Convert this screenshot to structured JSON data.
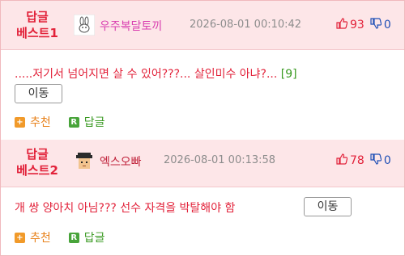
{
  "replies": [
    {
      "best_line1": "답글",
      "best_line2": "베스트1",
      "nickname": "우주복달토끼",
      "nickname_color": "#d93fb0",
      "timestamp": "2026-08-01 00:10:42",
      "likes": "93",
      "dislikes": "0",
      "text": ".....저기서 넘어지면 살 수 있어???... 살인미수 아냐?...",
      "comment_count": "[9]",
      "move_label": "이동",
      "recommend_label": "추천",
      "reply_label": "답글",
      "avatar": "bunny-icon"
    },
    {
      "best_line1": "답글",
      "best_line2": "베스트2",
      "nickname": "엑스오빠",
      "nickname_color": "#c0213a",
      "timestamp": "2026-08-01 00:13:58",
      "likes": "78",
      "dislikes": "0",
      "text": "개 쌍 양아치 아님??? 선수 자격을 박탈해야 함",
      "move_label": "이동",
      "recommend_label": "추천",
      "reply_label": "답글",
      "avatar": "pixel-face-icon"
    }
  ],
  "icons": {
    "recommend": "plus-badge-icon",
    "reply": "r-badge-icon",
    "like": "thumbs-up-icon",
    "dislike": "thumbs-down-icon"
  },
  "colors": {
    "best_red": "#e2223a",
    "header_bg": "#fde6e8",
    "like_red": "#e2223a",
    "dislike_blue": "#1f4fb6"
  }
}
